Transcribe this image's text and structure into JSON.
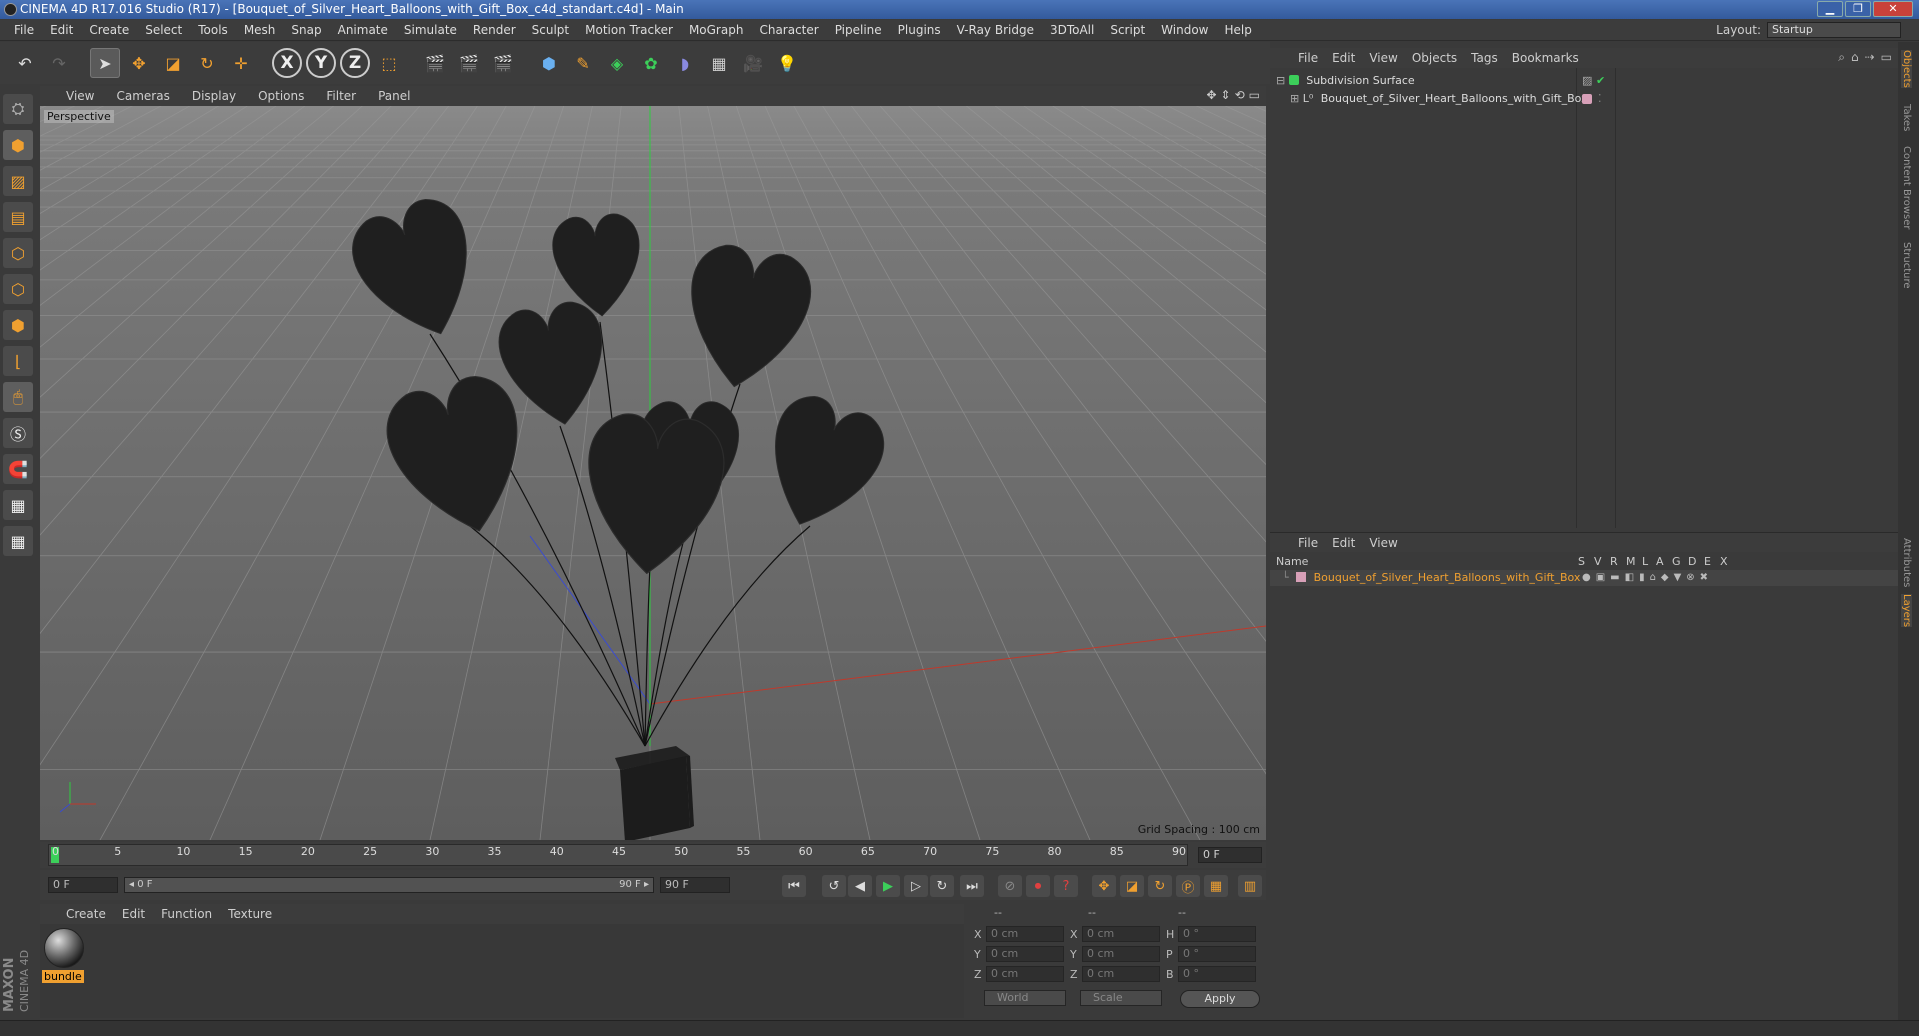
{
  "window": {
    "title": "CINEMA 4D R17.016 Studio (R17) - [Bouquet_of_Silver_Heart_Balloons_with_Gift_Box_c4d_standart.c4d] - Main",
    "min_glyph": "▁",
    "max_glyph": "❐",
    "close_glyph": "✕"
  },
  "menubar": {
    "items": [
      "File",
      "Edit",
      "Create",
      "Select",
      "Tools",
      "Mesh",
      "Snap",
      "Animate",
      "Simulate",
      "Render",
      "Sculpt",
      "Motion Tracker",
      "MoGraph",
      "Character",
      "Pipeline",
      "Plugins",
      "V-Ray Bridge",
      "3DToAll",
      "Script",
      "Window",
      "Help"
    ],
    "layout_label": "Layout:",
    "layout_value": "Startup"
  },
  "toolbar": {
    "axis_x": "X",
    "axis_y": "Y",
    "axis_z": "Z"
  },
  "viewport": {
    "menu": [
      "View",
      "Cameras",
      "Display",
      "Options",
      "Filter",
      "Panel"
    ],
    "label": "Perspective",
    "grid_spacing": "Grid Spacing : 100 cm",
    "colors": {
      "balloon": "#1f1f1f",
      "box": "#1c1c1c",
      "x_axis": "#c0392b",
      "y_axis": "#2ecc40",
      "z_axis": "#3a4bd0"
    }
  },
  "timeline": {
    "ticks": [
      "0",
      "5",
      "10",
      "15",
      "20",
      "25",
      "30",
      "35",
      "40",
      "45",
      "50",
      "55",
      "60",
      "65",
      "70",
      "75",
      "80",
      "85",
      "90"
    ],
    "end_field": "0 F"
  },
  "transport": {
    "start": "0 F",
    "slider_left": "◂ 0 F",
    "slider_right": "90 F ▸",
    "end": "90 F"
  },
  "material_panel": {
    "menu": [
      "Create",
      "Edit",
      "Function",
      "Texture"
    ],
    "material_name": "bundle"
  },
  "coordinates": {
    "header": [
      "--",
      "--",
      "--"
    ],
    "rows": [
      {
        "a": "X",
        "av": "0 cm",
        "b": "X",
        "bv": "0 cm",
        "c": "H",
        "cv": "0 °"
      },
      {
        "a": "Y",
        "av": "0 cm",
        "b": "Y",
        "bv": "0 cm",
        "c": "P",
        "cv": "0 °"
      },
      {
        "a": "Z",
        "av": "0 cm",
        "b": "Z",
        "bv": "0 cm",
        "c": "B",
        "cv": "0 °"
      }
    ],
    "world": "World",
    "scale": "Scale",
    "apply": "Apply"
  },
  "maxon": {
    "brand": "MAXON",
    "product": "CINEMA 4D"
  },
  "object_manager": {
    "menu": [
      "File",
      "Edit",
      "View",
      "Objects",
      "Tags",
      "Bookmarks"
    ],
    "objects": [
      {
        "name": "Subdivision Surface",
        "color": "#3ccf5a"
      },
      {
        "name": "Bouquet_of_Silver_Heart_Balloons_with_Gift_Box",
        "color": "#d8a0b8"
      }
    ]
  },
  "layer_manager": {
    "menu": [
      "File",
      "Edit",
      "View"
    ],
    "columns": [
      "Name",
      "S",
      "V",
      "R",
      "M",
      "L",
      "A",
      "G",
      "D",
      "E",
      "X"
    ],
    "layer_name": "Bouquet_of_Silver_Heart_Balloons_with_Gift_Box"
  },
  "right_tabs": [
    "Objects",
    "Takes",
    "Content Browser",
    "Structure",
    "Attributes",
    "Layers"
  ]
}
